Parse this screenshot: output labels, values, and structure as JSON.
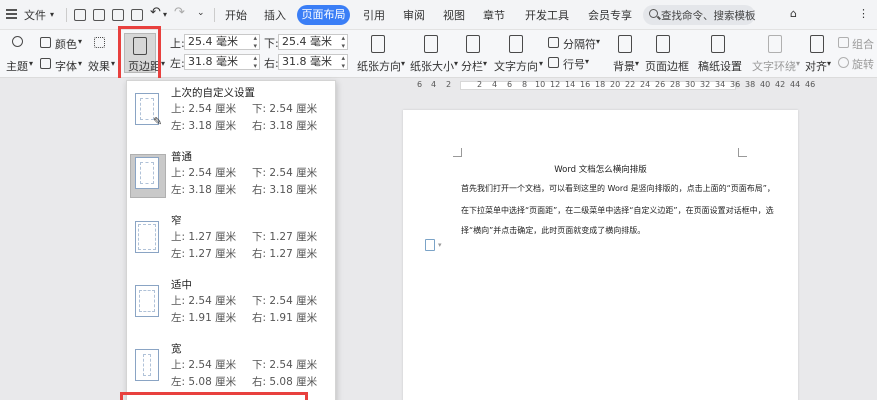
{
  "menubar": {
    "file": "文件",
    "tabs": [
      "开始",
      "插入",
      "页面布局",
      "引用",
      "审阅",
      "视图",
      "章节",
      "开发工具",
      "会员专享"
    ],
    "active_tab": "页面布局",
    "search_placeholder": "查找命令、搜索模板"
  },
  "ribbon": {
    "theme": "主题",
    "color": "颜色",
    "font": "字体",
    "effect": "效果",
    "margins": "页边距",
    "top_label": "上:",
    "top_value": "25.4 毫米",
    "bottom_label": "下:",
    "bottom_value": "25.4 毫米",
    "left_label": "左:",
    "left_value": "31.8 毫米",
    "right_label": "右:",
    "right_value": "31.8 毫米",
    "orientation": "纸张方向",
    "size": "纸张大小",
    "columns": "分栏",
    "text_direction": "文字方向",
    "line_numbers": "行号",
    "breaks": "分隔符",
    "background": "背景",
    "page_border": "页面边框",
    "manuscript": "稿纸设置",
    "text_wrap": "文字环绕",
    "align": "对齐",
    "rotate": "旋转",
    "group": "组合"
  },
  "ruler": {
    "numbers": [
      "6",
      "4",
      "2",
      "2",
      "4",
      "6",
      "8",
      "10",
      "12",
      "14",
      "16",
      "18",
      "20",
      "22",
      "24",
      "26",
      "28",
      "30",
      "32",
      "34",
      "36",
      "38",
      "40",
      "42",
      "44",
      "46"
    ]
  },
  "margins_menu": {
    "items": [
      {
        "name": "上次的自定义设置",
        "top": "上: 2.54 厘米",
        "bottom": "下: 2.54 厘米",
        "left": "左: 3.18 厘米",
        "right": "右: 3.18 厘米"
      },
      {
        "name": "普通",
        "top": "上: 2.54 厘米",
        "bottom": "下: 2.54 厘米",
        "left": "左: 3.18 厘米",
        "right": "右: 3.18 厘米"
      },
      {
        "name": "窄",
        "top": "上: 1.27 厘米",
        "bottom": "下: 1.27 厘米",
        "left": "左: 1.27 厘米",
        "right": "右: 1.27 厘米"
      },
      {
        "name": "适中",
        "top": "上: 2.54 厘米",
        "bottom": "下: 2.54 厘米",
        "left": "左: 1.91 厘米",
        "right": "右: 1.91 厘米"
      },
      {
        "name": "宽",
        "top": "上: 2.54 厘米",
        "bottom": "下: 2.54 厘米",
        "left": "左: 5.08 厘米",
        "right": "右: 5.08 厘米"
      }
    ]
  },
  "document": {
    "title": "Word 文档怎么横向排版",
    "lines": [
      "首先我们打开一个文档，可以看到这里的 Word 是竖向排版的，点击上面的“页面布局”，",
      "在下拉菜单中选择“页面距”，在二级菜单中选择“自定义边距”，在页面设置对话框中，选",
      "择“横向”并点击确定，此时页面就变成了横向排版。"
    ]
  },
  "colors": {
    "accent": "#3a7ef6",
    "highlight": "#e8403e"
  }
}
